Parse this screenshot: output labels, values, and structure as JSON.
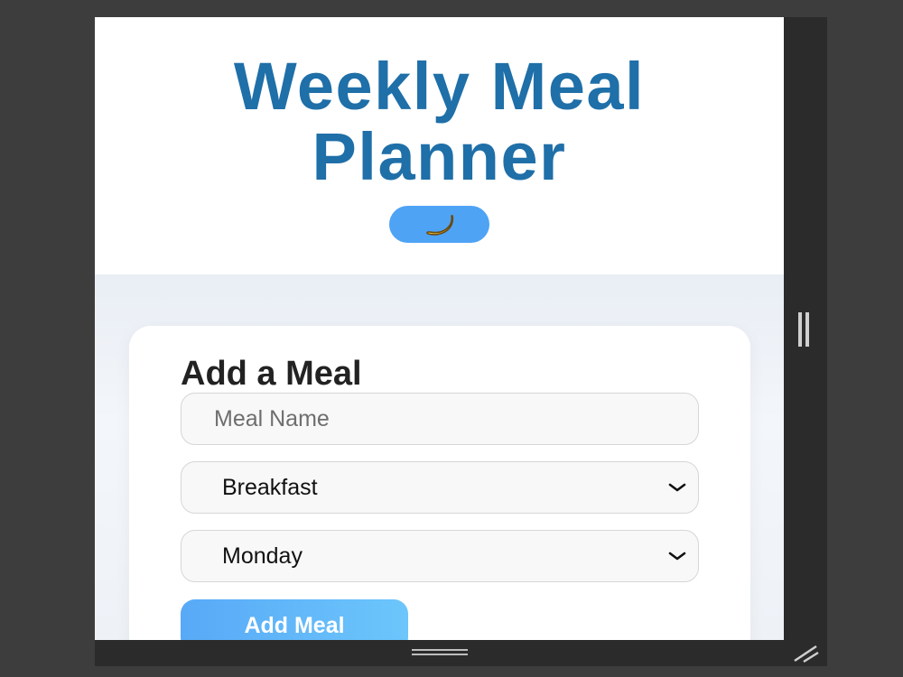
{
  "header": {
    "title_line1": "Weekly Meal",
    "title_line2": "Planner",
    "theme_toggle_icon": "banana-moon-icon"
  },
  "form": {
    "heading": "Add a Meal",
    "meal_name_placeholder": "Meal Name",
    "meal_name_value": "",
    "meal_type_selected": "Breakfast",
    "day_selected": "Monday",
    "submit_label": "Add Meal"
  },
  "colors": {
    "title": "#1f6fa8",
    "toggle_bg": "#4ea3f5",
    "button_gradient_start": "#58a9f7",
    "button_gradient_end": "#6cc6fb",
    "frame": "#2b2b2b",
    "outer_bg": "#3d3d3d"
  }
}
